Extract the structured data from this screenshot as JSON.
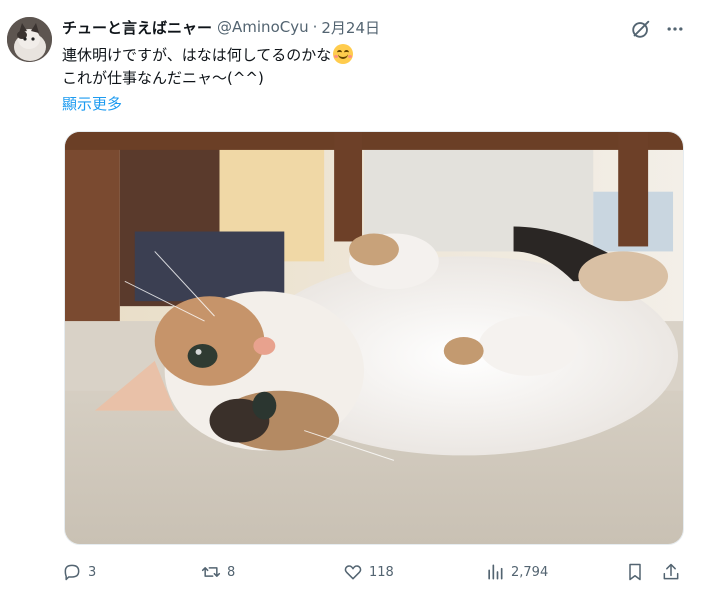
{
  "tweet": {
    "display_name": "チューと言えばニャー",
    "handle": "@AminoCyu",
    "separator": "·",
    "date": "2月24日",
    "text_line1": "連休明けですが、はなは何してるのかな",
    "text_line1_emoji": "smiling-face-emoji",
    "text_line2": "これが仕事なんだニャ～(^^)",
    "show_more": "顯示更多"
  },
  "icons": {
    "avatar": "cat-avatar",
    "grok": "grok-icon",
    "more": "more-dots-icon",
    "reply": "reply-icon",
    "retweet": "retweet-icon",
    "like": "heart-icon",
    "views": "views-chart-icon",
    "bookmark": "bookmark-icon",
    "share": "share-icon"
  },
  "media": {
    "subject": "cat-photo"
  },
  "metrics": {
    "replies": "3",
    "retweets": "8",
    "likes": "118",
    "views": "2,794"
  },
  "colors": {
    "text": "#0f1419",
    "secondary": "#536471",
    "link": "#1d9bf0"
  }
}
